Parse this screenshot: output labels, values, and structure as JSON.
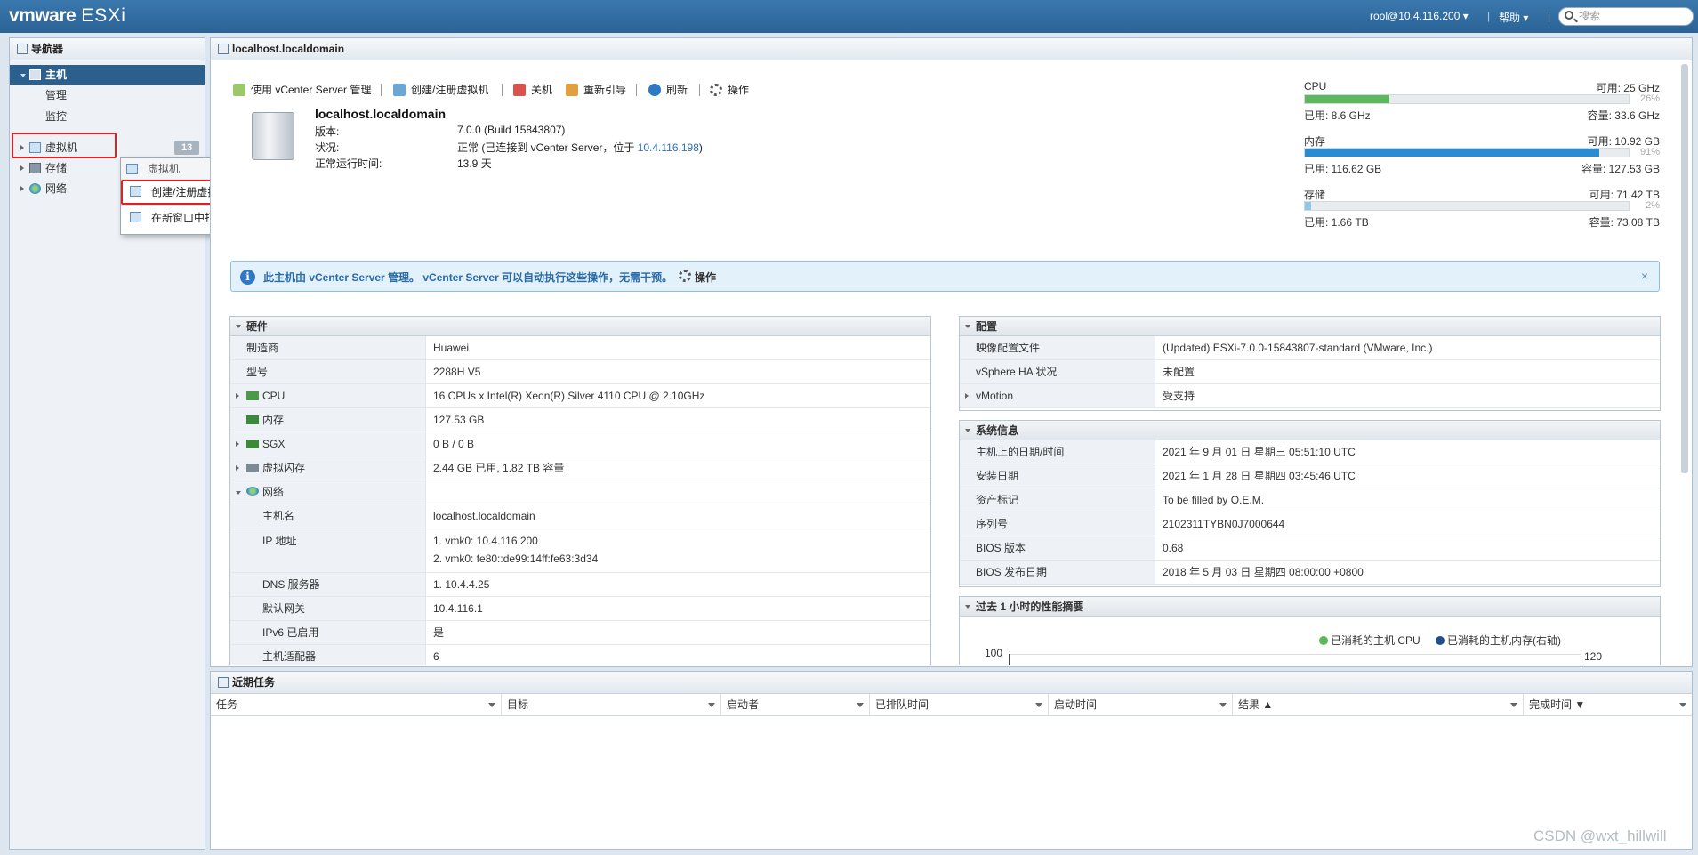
{
  "topbar": {
    "logo": "vmware",
    "product": "ESXi",
    "user": "rool@10.4.116.200",
    "help": "帮助",
    "search_placeholder": "搜索"
  },
  "navigator": {
    "title": "导航器",
    "host_label": "主机",
    "host_children": [
      "管理",
      "监控"
    ],
    "vm_label": "虚拟机",
    "vm_count": "13",
    "storage_label": "存储",
    "network_label": "网络"
  },
  "context_menu": {
    "header": "虚拟机",
    "items": [
      "创建/注册虚拟机",
      "在新窗口中打开"
    ]
  },
  "host_panel": {
    "title": "localhost.localdomain",
    "toolbar": [
      "使用 vCenter Server 管理",
      "创建/注册虚拟机",
      "关机",
      "重新引导",
      "刷新",
      "操作"
    ],
    "hostname": "localhost.localdomain",
    "version_label": "版本:",
    "version_value": "7.0.0 (Build 15843807)",
    "state_label": "状况:",
    "state_value": "正常 (已连接到 vCenter Server，位于 ",
    "state_link": "10.4.116.198",
    "state_close": ")",
    "uptime_label": "正常运行时间:",
    "uptime_value": "13.9 天"
  },
  "meters": [
    {
      "label": "CPU",
      "free": "可用: 25 GHz",
      "percent_text": "26%",
      "percent": 26,
      "used": "已用: 8.6 GHz",
      "capacity": "容量: 33.6 GHz",
      "color": "#5cb85c"
    },
    {
      "label": "内存",
      "free": "可用: 10.92 GB",
      "percent_text": "91%",
      "percent": 91,
      "used": "已用: 116.62 GB",
      "capacity": "容量: 127.53 GB",
      "color": "#2a8bd0"
    },
    {
      "label": "存储",
      "free": "可用: 71.42 TB",
      "percent_text": "2%",
      "percent": 2,
      "used": "已用: 1.66 TB",
      "capacity": "容量: 73.08 TB",
      "color": "#8fc9e6"
    }
  ],
  "banner": {
    "text": "此主机由 vCenter Server 管理。 vCenter Server 可以自动执行这些操作，无需干预。",
    "action": "操作",
    "close": "×"
  },
  "hardware": {
    "title": "硬件",
    "rows": [
      {
        "k": "制造商",
        "v": "Huawei"
      },
      {
        "k": "型号",
        "v": "2288H V5"
      },
      {
        "k": "CPU",
        "v": "16 CPUs x Intel(R) Xeon(R) Silver 4110 CPU @ 2.10GHz"
      },
      {
        "k": "内存",
        "v": "127.53 GB"
      },
      {
        "k": "SGX",
        "v": "0 B / 0 B"
      },
      {
        "k": "虚拟闪存",
        "v": "2.44 GB 已用, 1.82 TB 容量"
      },
      {
        "k": "网络",
        "v": ""
      },
      {
        "k": "主机名",
        "v": "localhost.localdomain"
      },
      {
        "k": "IP 地址",
        "v": "1. vmk0: 10.4.116.200",
        "v2": "2. vmk0: fe80::de99:14ff:fe63:3d34"
      },
      {
        "k": "DNS 服务器",
        "v": "1. 10.4.4.25"
      },
      {
        "k": "默认网关",
        "v": "10.4.116.1"
      },
      {
        "k": "IPv6 已启用",
        "v": "是"
      },
      {
        "k": "主机适配器",
        "v": "6"
      }
    ]
  },
  "config": {
    "title": "配置",
    "rows": [
      {
        "k": "映像配置文件",
        "v": "(Updated) ESXi-7.0.0-15843807-standard (VMware, Inc.)"
      },
      {
        "k": "vSphere HA 状况",
        "v": "未配置"
      },
      {
        "k": "vMotion",
        "v": "受支持"
      }
    ]
  },
  "sysinfo": {
    "title": "系统信息",
    "rows": [
      {
        "k": "主机上的日期/时间",
        "v": "2021 年 9 月 01 日 星期三 05:51:10 UTC"
      },
      {
        "k": "安装日期",
        "v": "2021 年 1 月 28 日 星期四 03:45:46 UTC"
      },
      {
        "k": "资产标记",
        "v": "To be filled by O.E.M."
      },
      {
        "k": "序列号",
        "v": "2102311TYBN0J7000644"
      },
      {
        "k": "BIOS 版本",
        "v": "0.68"
      },
      {
        "k": "BIOS 发布日期",
        "v": "2018 年 5 月 03 日 星期四 08:00:00 +0800"
      }
    ]
  },
  "perf": {
    "title": "过去 1 小时的性能摘要",
    "legend_cpu": "已消耗的主机 CPU",
    "legend_mem": "已消耗的主机内存(右轴)",
    "cpu_color": "#5cb85c",
    "mem_color": "#1f4e8c",
    "y_left_top": "100",
    "y_right_top": "120"
  },
  "tasks": {
    "title": "近期任务",
    "columns": [
      "任务",
      "目标",
      "启动者",
      "已排队时间",
      "启动时间",
      "结果 ▲",
      "完成时间 ▼"
    ]
  },
  "watermark": "CSDN @wxt_hillwill"
}
